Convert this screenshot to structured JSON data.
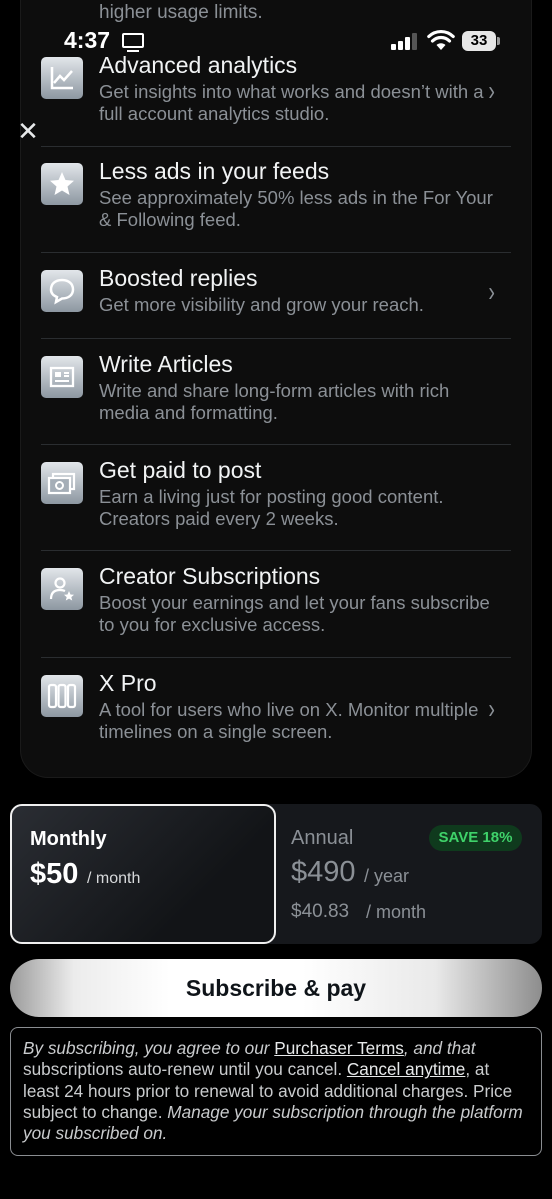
{
  "top_fragment": "higher usage limits.",
  "status_bar": {
    "time": "4:37",
    "battery": "33"
  },
  "features": [
    {
      "title": "Advanced analytics",
      "desc": "Get insights into what works and doesn’t with a full account analytics studio.",
      "icon": "chart-icon",
      "chevron": "›"
    },
    {
      "title": "Less ads in your feeds",
      "desc": "See approximately 50% less ads in the For Your & Following feed.",
      "icon": "star-icon"
    },
    {
      "title": "Boosted replies",
      "desc": "Get more visibility and grow your reach.",
      "icon": "speech-bubble-icon",
      "chevron": "›"
    },
    {
      "title": "Write Articles",
      "desc": "Write and share long-form articles with rich media and formatting.",
      "icon": "article-icon"
    },
    {
      "title": "Get paid to post",
      "desc": "Earn a living just for posting good content. Creators paid every 2 weeks.",
      "icon": "money-icon"
    },
    {
      "title": "Creator Subscriptions",
      "desc": "Boost your earnings and let your fans subscribe to you for exclusive access.",
      "icon": "person-star-icon"
    },
    {
      "title": "X Pro",
      "desc": "A tool for users who live on X. Monitor multiple timelines on a single screen.",
      "icon": "columns-icon",
      "chevron": "›"
    }
  ],
  "plans": {
    "monthly": {
      "label": "Monthly",
      "price": "$50",
      "per": "/ month",
      "selected": true
    },
    "annual": {
      "label": "Annual",
      "price": "$490",
      "per": "/ year",
      "monthly_price": "$40.83",
      "monthly_per": "/ month",
      "badge": "SAVE 18%"
    }
  },
  "subscribe_label": "Subscribe & pay",
  "terms": {
    "p1": "By subscribing, you agree to our ",
    "link1": "Purchaser Terms",
    "p2": ", and that",
    "p3": " subscriptions auto-renew until you cancel. ",
    "link2": "Cancel anytime",
    "p4": ", at least 24 hours prior to renewal to avoid additional charges. Price subject to change. ",
    "p5": "Manage your subscription through the platform you subscribed on."
  },
  "colors": {
    "accent_green": "#3fd26a",
    "background": "#000000",
    "muted_text": "#8b9096"
  }
}
